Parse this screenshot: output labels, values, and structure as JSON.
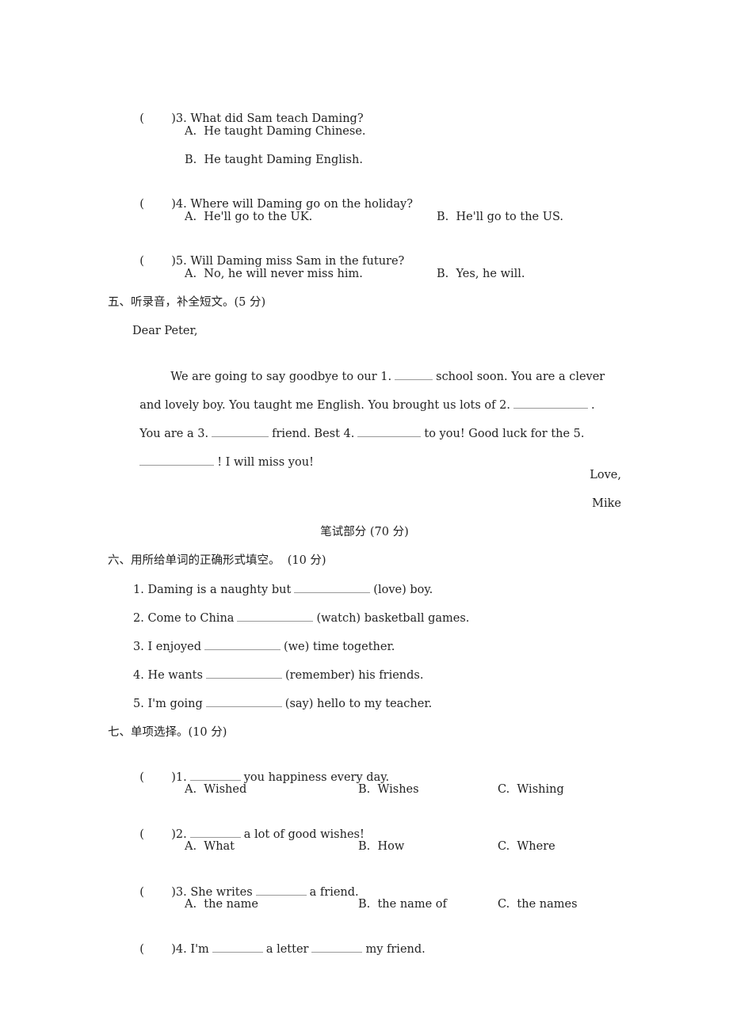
{
  "listening_questions": [
    {
      "num": "3.",
      "question": "What did Sam teach Daming?",
      "options": [
        "A.  He taught Daming Chinese.",
        "B.  He taught Daming English."
      ]
    },
    {
      "num": "4.",
      "question": "Where will Daming go on the holiday?",
      "options": [
        "A.  He'll go to the UK.",
        "B.  He'll go to the US."
      ]
    },
    {
      "num": "5.",
      "question": "Will Daming miss Sam in the future?",
      "options": [
        "A.  No, he will never miss him.",
        "B.  Yes, he will."
      ]
    }
  ],
  "section5": {
    "title": "五、听录音，补全短文。(5 分)",
    "greeting": "Dear Peter,",
    "p1a": "We are going to say goodbye to our 1.",
    "p1b": "school soon. You are a clever",
    "p2a": "and lovely boy. You taught me English. You brought us lots of 2.",
    "p2b": ".",
    "p3a": "You are a 3.",
    "p3b": "friend. Best 4.",
    "p3c": "to you! Good luck for the 5.",
    "p4b": "! I will miss you!",
    "closing": "Love,",
    "signature": "Mike"
  },
  "written_part_title": "笔试部分 (70 分)",
  "section6": {
    "title": "六、用所给单词的正确形式填空。  (10 分)",
    "items": [
      {
        "pre": "1. Daming is a naughty but",
        "post": "(love) boy."
      },
      {
        "pre": "2. Come to China",
        "post": "(watch) basketball games."
      },
      {
        "pre": "3. I enjoyed",
        "post": "(we) time together."
      },
      {
        "pre": "4. He wants",
        "post": "(remember) his friends."
      },
      {
        "pre": "5. I'm going",
        "post": "(say) hello to my teacher."
      }
    ]
  },
  "section7": {
    "title": "七、单项选择。(10 分)",
    "items": [
      {
        "num": "1.",
        "pre": "",
        "post": "you happiness every day.",
        "options": [
          "A.  Wished",
          "B.  Wishes",
          "C.  Wishing"
        ]
      },
      {
        "num": "2.",
        "pre": "",
        "post": "a lot of good wishes!",
        "options": [
          "A.  What",
          "B.  How",
          "C.  Where"
        ]
      },
      {
        "num": "3.",
        "pre": "She writes",
        "post": "a friend.",
        "options": [
          "A.  the name",
          "B.  the name of",
          "C.  the names"
        ]
      },
      {
        "num": "4.",
        "pre": "I'm",
        "mid": "a letter",
        "post": "my friend."
      }
    ]
  },
  "paren_open": "(",
  "paren_close": ")"
}
